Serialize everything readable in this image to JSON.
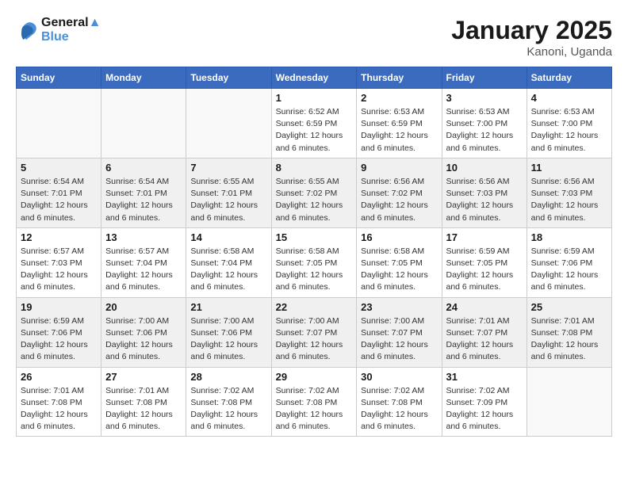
{
  "header": {
    "logo_line1": "General",
    "logo_line2": "Blue",
    "month_title": "January 2025",
    "location": "Kanoni, Uganda"
  },
  "weekdays": [
    "Sunday",
    "Monday",
    "Tuesday",
    "Wednesday",
    "Thursday",
    "Friday",
    "Saturday"
  ],
  "weeks": [
    {
      "shaded": false,
      "days": [
        {
          "num": "",
          "info": ""
        },
        {
          "num": "",
          "info": ""
        },
        {
          "num": "",
          "info": ""
        },
        {
          "num": "1",
          "info": "Sunrise: 6:52 AM\nSunset: 6:59 PM\nDaylight: 12 hours\nand 6 minutes."
        },
        {
          "num": "2",
          "info": "Sunrise: 6:53 AM\nSunset: 6:59 PM\nDaylight: 12 hours\nand 6 minutes."
        },
        {
          "num": "3",
          "info": "Sunrise: 6:53 AM\nSunset: 7:00 PM\nDaylight: 12 hours\nand 6 minutes."
        },
        {
          "num": "4",
          "info": "Sunrise: 6:53 AM\nSunset: 7:00 PM\nDaylight: 12 hours\nand 6 minutes."
        }
      ]
    },
    {
      "shaded": true,
      "days": [
        {
          "num": "5",
          "info": "Sunrise: 6:54 AM\nSunset: 7:01 PM\nDaylight: 12 hours\nand 6 minutes."
        },
        {
          "num": "6",
          "info": "Sunrise: 6:54 AM\nSunset: 7:01 PM\nDaylight: 12 hours\nand 6 minutes."
        },
        {
          "num": "7",
          "info": "Sunrise: 6:55 AM\nSunset: 7:01 PM\nDaylight: 12 hours\nand 6 minutes."
        },
        {
          "num": "8",
          "info": "Sunrise: 6:55 AM\nSunset: 7:02 PM\nDaylight: 12 hours\nand 6 minutes."
        },
        {
          "num": "9",
          "info": "Sunrise: 6:56 AM\nSunset: 7:02 PM\nDaylight: 12 hours\nand 6 minutes."
        },
        {
          "num": "10",
          "info": "Sunrise: 6:56 AM\nSunset: 7:03 PM\nDaylight: 12 hours\nand 6 minutes."
        },
        {
          "num": "11",
          "info": "Sunrise: 6:56 AM\nSunset: 7:03 PM\nDaylight: 12 hours\nand 6 minutes."
        }
      ]
    },
    {
      "shaded": false,
      "days": [
        {
          "num": "12",
          "info": "Sunrise: 6:57 AM\nSunset: 7:03 PM\nDaylight: 12 hours\nand 6 minutes."
        },
        {
          "num": "13",
          "info": "Sunrise: 6:57 AM\nSunset: 7:04 PM\nDaylight: 12 hours\nand 6 minutes."
        },
        {
          "num": "14",
          "info": "Sunrise: 6:58 AM\nSunset: 7:04 PM\nDaylight: 12 hours\nand 6 minutes."
        },
        {
          "num": "15",
          "info": "Sunrise: 6:58 AM\nSunset: 7:05 PM\nDaylight: 12 hours\nand 6 minutes."
        },
        {
          "num": "16",
          "info": "Sunrise: 6:58 AM\nSunset: 7:05 PM\nDaylight: 12 hours\nand 6 minutes."
        },
        {
          "num": "17",
          "info": "Sunrise: 6:59 AM\nSunset: 7:05 PM\nDaylight: 12 hours\nand 6 minutes."
        },
        {
          "num": "18",
          "info": "Sunrise: 6:59 AM\nSunset: 7:06 PM\nDaylight: 12 hours\nand 6 minutes."
        }
      ]
    },
    {
      "shaded": true,
      "days": [
        {
          "num": "19",
          "info": "Sunrise: 6:59 AM\nSunset: 7:06 PM\nDaylight: 12 hours\nand 6 minutes."
        },
        {
          "num": "20",
          "info": "Sunrise: 7:00 AM\nSunset: 7:06 PM\nDaylight: 12 hours\nand 6 minutes."
        },
        {
          "num": "21",
          "info": "Sunrise: 7:00 AM\nSunset: 7:06 PM\nDaylight: 12 hours\nand 6 minutes."
        },
        {
          "num": "22",
          "info": "Sunrise: 7:00 AM\nSunset: 7:07 PM\nDaylight: 12 hours\nand 6 minutes."
        },
        {
          "num": "23",
          "info": "Sunrise: 7:00 AM\nSunset: 7:07 PM\nDaylight: 12 hours\nand 6 minutes."
        },
        {
          "num": "24",
          "info": "Sunrise: 7:01 AM\nSunset: 7:07 PM\nDaylight: 12 hours\nand 6 minutes."
        },
        {
          "num": "25",
          "info": "Sunrise: 7:01 AM\nSunset: 7:08 PM\nDaylight: 12 hours\nand 6 minutes."
        }
      ]
    },
    {
      "shaded": false,
      "days": [
        {
          "num": "26",
          "info": "Sunrise: 7:01 AM\nSunset: 7:08 PM\nDaylight: 12 hours\nand 6 minutes."
        },
        {
          "num": "27",
          "info": "Sunrise: 7:01 AM\nSunset: 7:08 PM\nDaylight: 12 hours\nand 6 minutes."
        },
        {
          "num": "28",
          "info": "Sunrise: 7:02 AM\nSunset: 7:08 PM\nDaylight: 12 hours\nand 6 minutes."
        },
        {
          "num": "29",
          "info": "Sunrise: 7:02 AM\nSunset: 7:08 PM\nDaylight: 12 hours\nand 6 minutes."
        },
        {
          "num": "30",
          "info": "Sunrise: 7:02 AM\nSunset: 7:08 PM\nDaylight: 12 hours\nand 6 minutes."
        },
        {
          "num": "31",
          "info": "Sunrise: 7:02 AM\nSunset: 7:09 PM\nDaylight: 12 hours\nand 6 minutes."
        },
        {
          "num": "",
          "info": ""
        }
      ]
    }
  ]
}
